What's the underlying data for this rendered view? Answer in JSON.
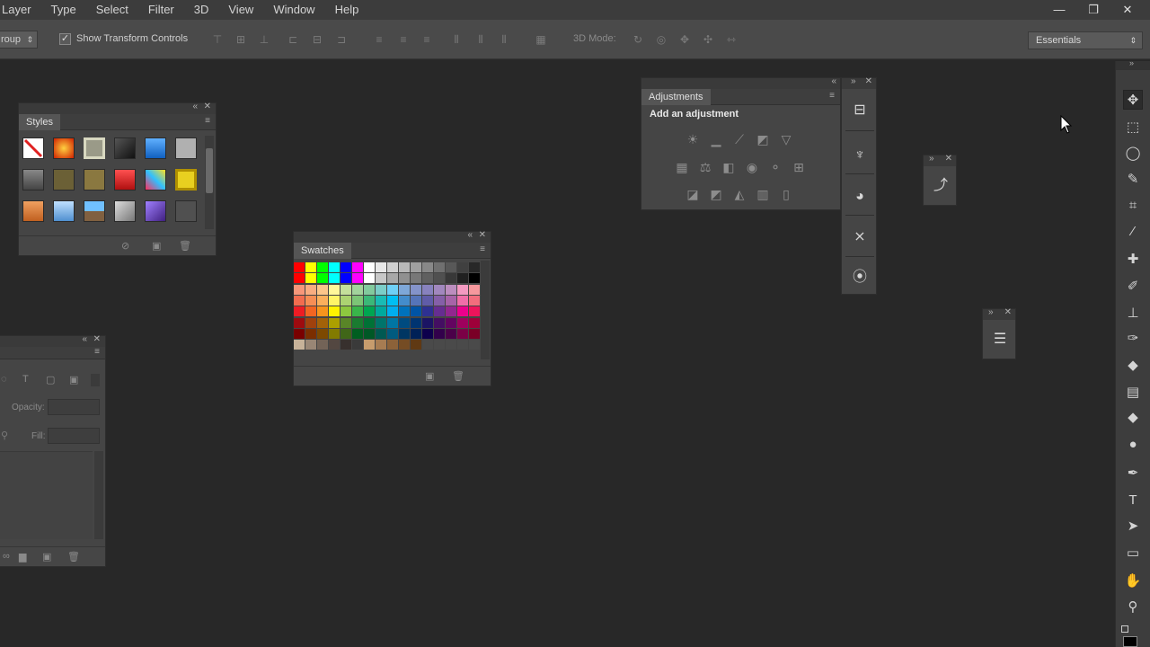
{
  "menu": [
    "Layer",
    "Type",
    "Select",
    "Filter",
    "3D",
    "View",
    "Window",
    "Help"
  ],
  "window_controls": {
    "minimize": "—",
    "restore": "❐",
    "close": "✕"
  },
  "options": {
    "auto_select_value": "roup",
    "show_transform_label": "Show Transform Controls",
    "show_transform_checked": "✓",
    "mode_label": "3D Mode:",
    "workspace": "Essentials"
  },
  "panels": {
    "styles": {
      "tab": "Styles"
    },
    "swatches": {
      "tab": "Swatches"
    },
    "adjustments": {
      "tab": "Adjustments",
      "heading": "Add an adjustment"
    },
    "layers": {
      "opacity_label": "Opacity:",
      "fill_label": "Fill:"
    }
  },
  "colors": {
    "menubar": "#3c3c3c",
    "optionsbar": "#4a4a4a",
    "canvas": "#282828",
    "panel": "#454545"
  }
}
